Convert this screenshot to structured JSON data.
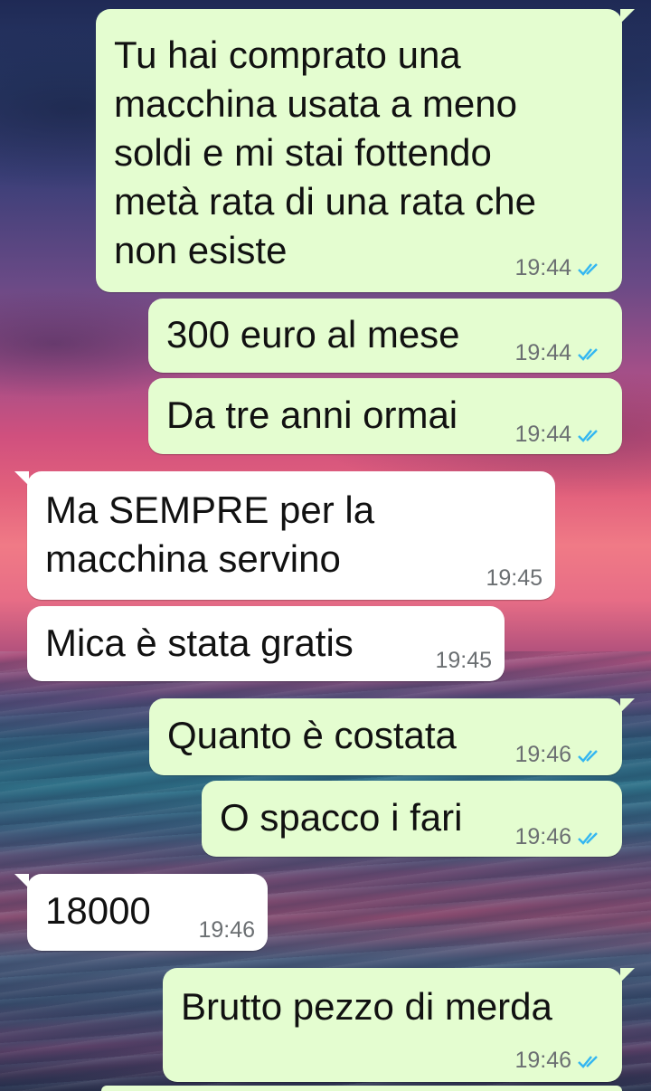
{
  "messages": [
    {
      "direction": "outgoing",
      "text": "Tu hai comprato una\nmacchina usata a meno\nsoldi e mi stai fottendo\nmetà rata di una rata che\nnon esiste",
      "time": "19:44",
      "status": "read"
    },
    {
      "direction": "outgoing",
      "text": "300 euro al mese",
      "time": "19:44",
      "status": "read"
    },
    {
      "direction": "outgoing",
      "text": "Da tre anni ormai",
      "time": "19:44",
      "status": "read"
    },
    {
      "direction": "incoming",
      "text": "Ma SEMPRE per la\nmacchina servino",
      "time": "19:45"
    },
    {
      "direction": "incoming",
      "text": "Mica è stata gratis",
      "time": "19:45"
    },
    {
      "direction": "outgoing",
      "text": "Quanto è costata",
      "time": "19:46",
      "status": "read"
    },
    {
      "direction": "outgoing",
      "text": "O spacco i fari",
      "time": "19:46",
      "status": "read"
    },
    {
      "direction": "incoming",
      "text": "18000",
      "time": "19:46"
    },
    {
      "direction": "outgoing",
      "text": "Brutto pezzo di merda",
      "time": "19:46",
      "status": "read"
    }
  ],
  "colors": {
    "outgoing_bubble": "#e4fdd0",
    "incoming_bubble": "#ffffff",
    "read_tick": "#34b7f1"
  },
  "icons": {
    "read_receipt": "double-check-icon"
  }
}
